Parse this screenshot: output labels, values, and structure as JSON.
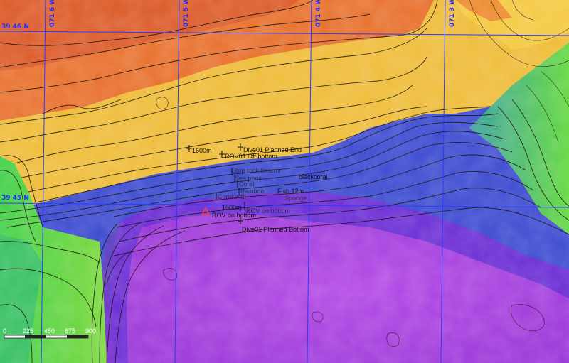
{
  "grid": {
    "lon_labels": [
      "071 6 W",
      "071 5 W",
      "071 4 W",
      "071 3 W"
    ],
    "lat_labels": [
      "39 46 N",
      "39 45 N"
    ]
  },
  "annotations": {
    "depth_1600_upper": "1600m",
    "dive01_planned_end": "Dive01 Planned End",
    "rov01_off_bottom": "ROV01 Off bottom",
    "black_coral": "blackcoral",
    "depth_1600_lower": "1600m",
    "rov_on_bottom": "ROV on bottom",
    "dive01_planned_bottom": "Dive01 Planned Bottom",
    "overlap_1": "Stop rock forams",
    "overlap_2": "Sea pens",
    "overlap_3": "Coral",
    "overlap_4": "Bamboo",
    "overlap_5": "Fish 12m",
    "overlap_6": "Coral wall",
    "overlap_7": "Sponge",
    "overlap_8": "ROV on bottom"
  },
  "scale_bar": {
    "ticks": [
      "0",
      "225",
      "450",
      "675",
      "900"
    ]
  },
  "colors": {
    "shallow": "#e0652a",
    "orange": "#f09a2a",
    "yellow": "#eec83a",
    "green": "#6ad83a",
    "blue": "#3a6ae0",
    "violet": "#6a30d8",
    "purple": "#b040e0",
    "grid": "#2a3cff"
  },
  "markers": {
    "triangle": "warning-triangle-icon"
  }
}
